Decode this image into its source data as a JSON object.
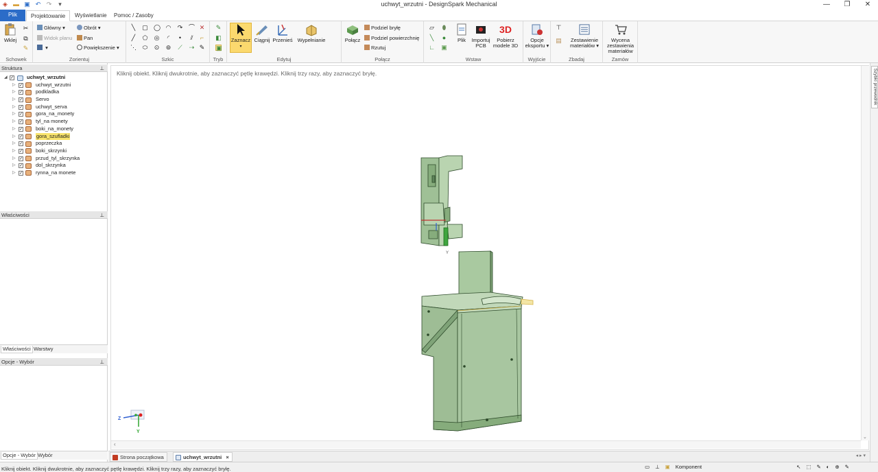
{
  "window": {
    "title": "uchwyt_wrzutni - DesignSpark Mechanical",
    "icons": [
      "app-logo-icon",
      "open-folder-icon",
      "save-icon",
      "undo-icon",
      "redo-icon",
      "customize-icon"
    ],
    "controls": {
      "minimize": "—",
      "restore": "❐",
      "close": "✕"
    }
  },
  "tabs": [
    {
      "label": "Plik"
    },
    {
      "label": "Projektowanie"
    },
    {
      "label": "Wyświetlanie"
    },
    {
      "label": "Pomoc / Zasoby"
    }
  ],
  "ribbon": {
    "schowek": {
      "label": "Schowek",
      "paste": "Wklej"
    },
    "zorientuj": {
      "label": "Zorientuj",
      "main": "Główny",
      "plan": "Widok planu",
      "rotate": "Obrót",
      "pan": "Pan",
      "zoom": "Powiększenie"
    },
    "szkic": {
      "label": "Szkic"
    },
    "tryb": {
      "label": "Tryb"
    },
    "edytuj": {
      "label": "Edytuj",
      "select": "Zaznacz",
      "pull": "Ciągnij",
      "move": "Przenieś",
      "fill": "Wypełnianie"
    },
    "polacz": {
      "label": "Połącz",
      "combine": "Połącz",
      "split_body": "Podziel bryłę",
      "split_face": "Podziel powierzchnię",
      "project": "Rzutuj"
    },
    "wstaw": {
      "label": "Wstaw",
      "file": "Plik",
      "pcb": "Importuj PCB",
      "model3d": "Pobierz modele 3D",
      "badge3d": "3D"
    },
    "wyjscie": {
      "label": "Wyjście",
      "export": "Opcje eksportu"
    },
    "zbadaj": {
      "label": "Zbadaj",
      "bom": "Zestawienie materiałów"
    },
    "zamow": {
      "label": "Zamów",
      "quote": "Wycena zestawienia materiałów"
    }
  },
  "structure": {
    "header": "Struktura",
    "root": "uchwyt_wrzutni",
    "items": [
      {
        "label": "uchwyt_wrzutni"
      },
      {
        "label": "podkladka"
      },
      {
        "label": "Servo"
      },
      {
        "label": "uchwyt_serva"
      },
      {
        "label": "gora_na_monety"
      },
      {
        "label": "tyl_na monety"
      },
      {
        "label": "boki_na_monety"
      },
      {
        "label": "gora_szufladki"
      },
      {
        "label": "poprzeczka"
      },
      {
        "label": "boki_skrzynki"
      },
      {
        "label": "przud_tyl_skrzynka"
      },
      {
        "label": "dol_skrzynka"
      },
      {
        "label": "rynna_na monete"
      }
    ],
    "selected_index": 7
  },
  "properties": {
    "header": "Właściwości",
    "tab_props": "Właściwości",
    "tab_layers": "Warstwy"
  },
  "options": {
    "header": "Opcje - Wybór",
    "tab_options": "Opcje - Wybór",
    "tab_select": "Wybór"
  },
  "viewport": {
    "hint": "Kliknij obiekt. Kliknij dwukrotnie, aby zaznaczyć pętlę krawędzi. Kliknij trzy razy, aby zaznaczyć bryłę.",
    "axis_x": "Z",
    "axis_y": "Y",
    "axis_small": "Y"
  },
  "right_panel": {
    "label": "Szybki przewodnik"
  },
  "doc_tabs": [
    {
      "label": "Strona początkowa"
    },
    {
      "label": "uchwyt_wrzutni"
    }
  ],
  "doc_tab_close": "×",
  "status": {
    "text": "Kliknij obiekt. Kliknij dwukrotnie, aby zaznaczyć pętlę krawędzi. Kliknij trzy razy, aby zaznaczyć bryłę.",
    "mode": "Komponent"
  },
  "colors": {
    "accent": "#2b6cc8",
    "highlight": "#fbd96e",
    "model_fill": "#9fc096",
    "model_edge": "#2d4a2a"
  }
}
